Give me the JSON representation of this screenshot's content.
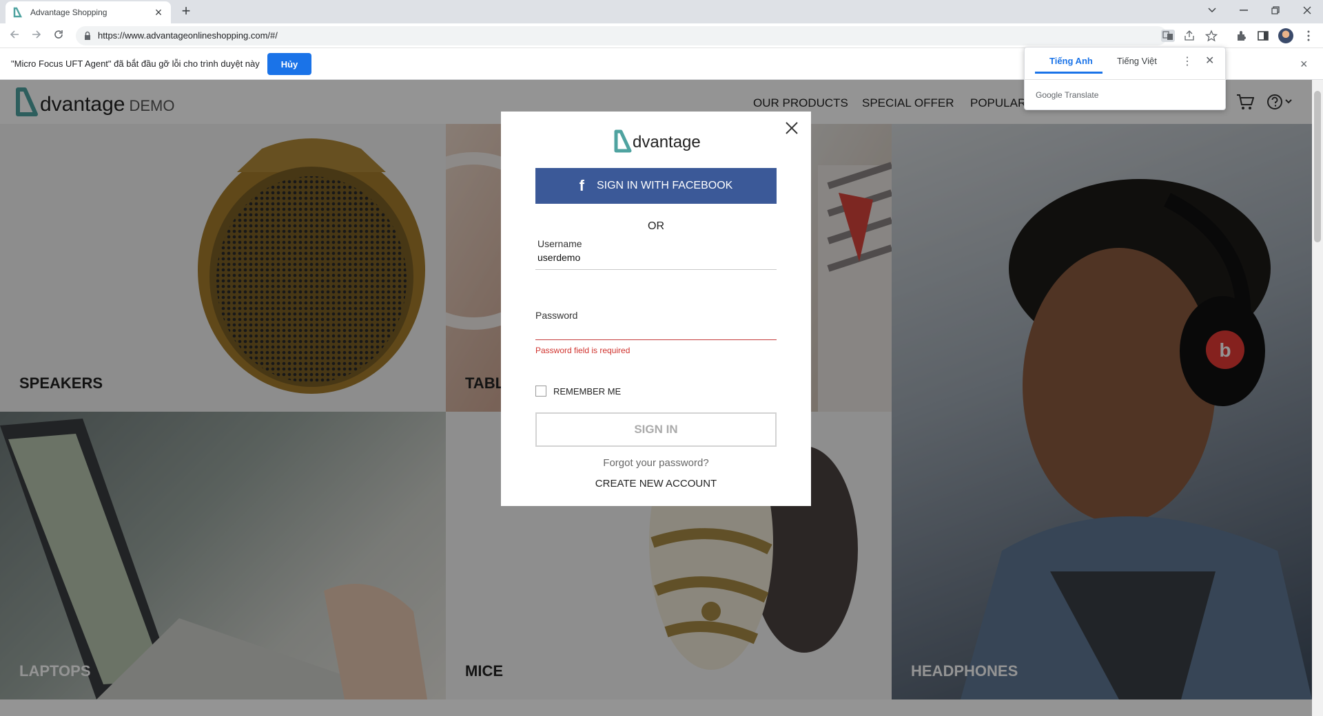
{
  "browser": {
    "tab_title": "Advantage Shopping",
    "tab_close": "×",
    "new_tab": "+",
    "url": "https://www.advantageonlineshopping.com/#/",
    "window_controls": [
      "chevron-down",
      "minimize",
      "restore",
      "close"
    ]
  },
  "infobar": {
    "message": "\"Micro Focus UFT Agent\" đã bắt đầu gỡ lỗi cho trình duyệt này",
    "cancel_label": "Hủy",
    "close": "×"
  },
  "translate_popup": {
    "lang_source": "Tiếng Anh",
    "lang_target": "Tiếng Việt",
    "brand_google": "Google",
    "brand_translate": "Translate",
    "more": "⋮",
    "close": "✕"
  },
  "site": {
    "logo_word": "dvantage",
    "logo_demo": "DEMO",
    "nav": [
      "OUR PRODUCTS",
      "SPECIAL OFFER",
      "POPULAR ITEMS"
    ]
  },
  "categories": [
    "SPEAKERS",
    "TABLETS",
    "HEADPHONES",
    "LAPTOPS",
    "MICE"
  ],
  "login": {
    "logo_word": "dvantage",
    "facebook_label": "SIGN IN WITH FACEBOOK",
    "facebook_glyph": "f",
    "or_label": "OR",
    "username_label": "Username",
    "username_value": "userdemo",
    "password_label": "Password",
    "password_error": "Password field is required",
    "remember_label": "REMEMBER ME",
    "signin_label": "SIGN IN",
    "forgot_label": "Forgot your password?",
    "create_label": "CREATE NEW ACCOUNT"
  },
  "colors": {
    "brand_teal": "#4fa3a0",
    "facebook_blue": "#3b5998",
    "chrome_blue": "#1a73e8",
    "error_red": "#d0332e"
  }
}
